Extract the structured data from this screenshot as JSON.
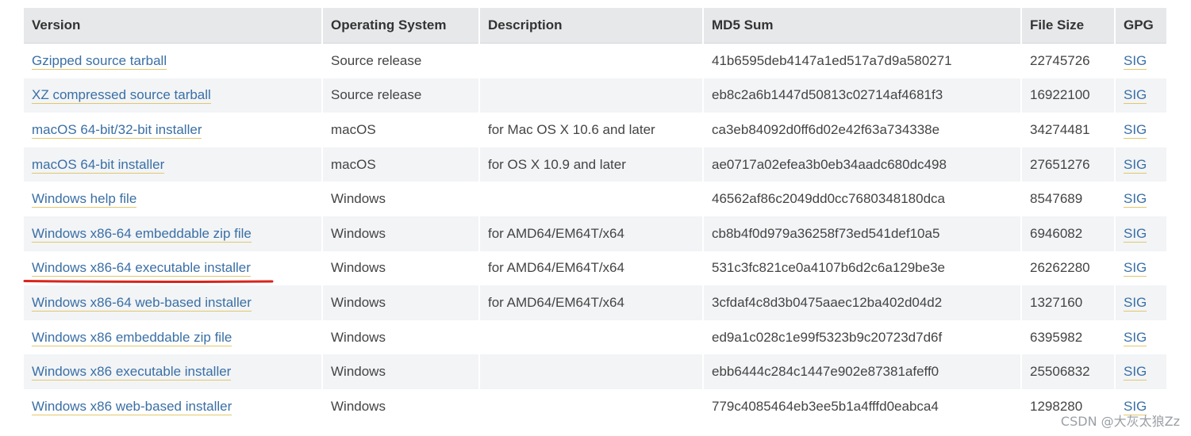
{
  "headers": {
    "version": "Version",
    "os": "Operating System",
    "description": "Description",
    "md5": "MD5 Sum",
    "size": "File Size",
    "gpg": "GPG"
  },
  "rows": [
    {
      "version": "Gzipped source tarball",
      "os": "Source release",
      "description": "",
      "md5": "41b6595deb4147a1ed517a7d9a580271",
      "size": "22745726",
      "gpg": "SIG"
    },
    {
      "version": "XZ compressed source tarball",
      "os": "Source release",
      "description": "",
      "md5": "eb8c2a6b1447d50813c02714af4681f3",
      "size": "16922100",
      "gpg": "SIG"
    },
    {
      "version": "macOS 64-bit/32-bit installer",
      "os": "macOS",
      "description": "for Mac OS X 10.6 and later",
      "md5": "ca3eb84092d0ff6d02e42f63a734338e",
      "size": "34274481",
      "gpg": "SIG"
    },
    {
      "version": "macOS 64-bit installer",
      "os": "macOS",
      "description": "for OS X 10.9 and later",
      "md5": "ae0717a02efea3b0eb34aadc680dc498",
      "size": "27651276",
      "gpg": "SIG"
    },
    {
      "version": "Windows help file",
      "os": "Windows",
      "description": "",
      "md5": "46562af86c2049dd0cc7680348180dca",
      "size": "8547689",
      "gpg": "SIG"
    },
    {
      "version": "Windows x86-64 embeddable zip file",
      "os": "Windows",
      "description": "for AMD64/EM64T/x64",
      "md5": "cb8b4f0d979a36258f73ed541def10a5",
      "size": "6946082",
      "gpg": "SIG"
    },
    {
      "version": "Windows x86-64 executable installer",
      "os": "Windows",
      "description": "for AMD64/EM64T/x64",
      "md5": "531c3fc821ce0a4107b6d2c6a129be3e",
      "size": "26262280",
      "gpg": "SIG"
    },
    {
      "version": "Windows x86-64 web-based installer",
      "os": "Windows",
      "description": "for AMD64/EM64T/x64",
      "md5": "3cfdaf4c8d3b0475aaec12ba402d04d2",
      "size": "1327160",
      "gpg": "SIG"
    },
    {
      "version": "Windows x86 embeddable zip file",
      "os": "Windows",
      "description": "",
      "md5": "ed9a1c028c1e99f5323b9c20723d7d6f",
      "size": "6395982",
      "gpg": "SIG"
    },
    {
      "version": "Windows x86 executable installer",
      "os": "Windows",
      "description": "",
      "md5": "ebb6444c284c1447e902e87381afeff0",
      "size": "25506832",
      "gpg": "SIG"
    },
    {
      "version": "Windows x86 web-based installer",
      "os": "Windows",
      "description": "",
      "md5": "779c4085464eb3ee5b1a4fffd0eabca4",
      "size": "1298280",
      "gpg": "SIG"
    }
  ],
  "watermark": "CSDN @大灰太狼Zz",
  "colors": {
    "link": "#3a6fa5",
    "link_underline": "#e2c76d",
    "header_bg": "#e6e8ea",
    "row_alt_bg": "#f2f4f6",
    "annotation_red": "#d9241c"
  }
}
